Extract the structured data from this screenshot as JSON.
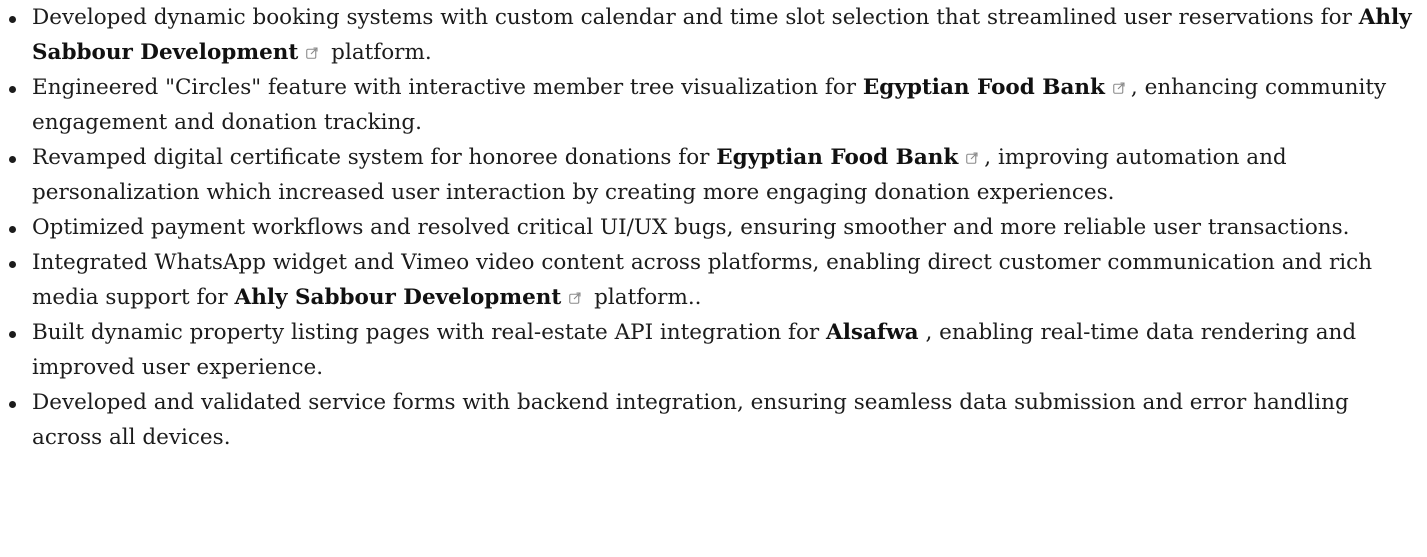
{
  "items": [
    {
      "pre": "Developed dynamic booking systems with custom calendar and time slot selection that streamlined user reservations for ",
      "org": "Ahly Sabbour Development",
      "post": " platform."
    },
    {
      "pre": "Engineered \"Circles\" feature with interactive member tree visualization for ",
      "org": "Egyptian Food Bank",
      "post": ", enhancing community engagement and donation tracking."
    },
    {
      "pre": "Revamped digital certificate system for honoree donations for ",
      "org": "Egyptian Food Bank",
      "post": ", improving automation and personalization which increased user interaction by creating more engaging donation experiences."
    },
    {
      "text": "Optimized payment workflows and resolved critical UI/UX bugs, ensuring smoother and more reliable user transactions."
    },
    {
      "pre": "Integrated WhatsApp widget and Vimeo video content across platforms, enabling direct customer communication and rich media support for ",
      "org": "Ahly Sabbour Development",
      "post": " platform.."
    },
    {
      "pre": "Built dynamic property listing pages with real-estate API integration for ",
      "org": "Alsafwa",
      "post": " , enabling real-time data rendering and improved user experience."
    },
    {
      "text": "Developed and validated service forms with backend integration, ensuring seamless data submission and error handling across all devices."
    }
  ],
  "icons": {
    "external_link": "external-link-icon"
  },
  "colors": {
    "text": "#1c1c1c",
    "icon": "#8a8a8a"
  }
}
